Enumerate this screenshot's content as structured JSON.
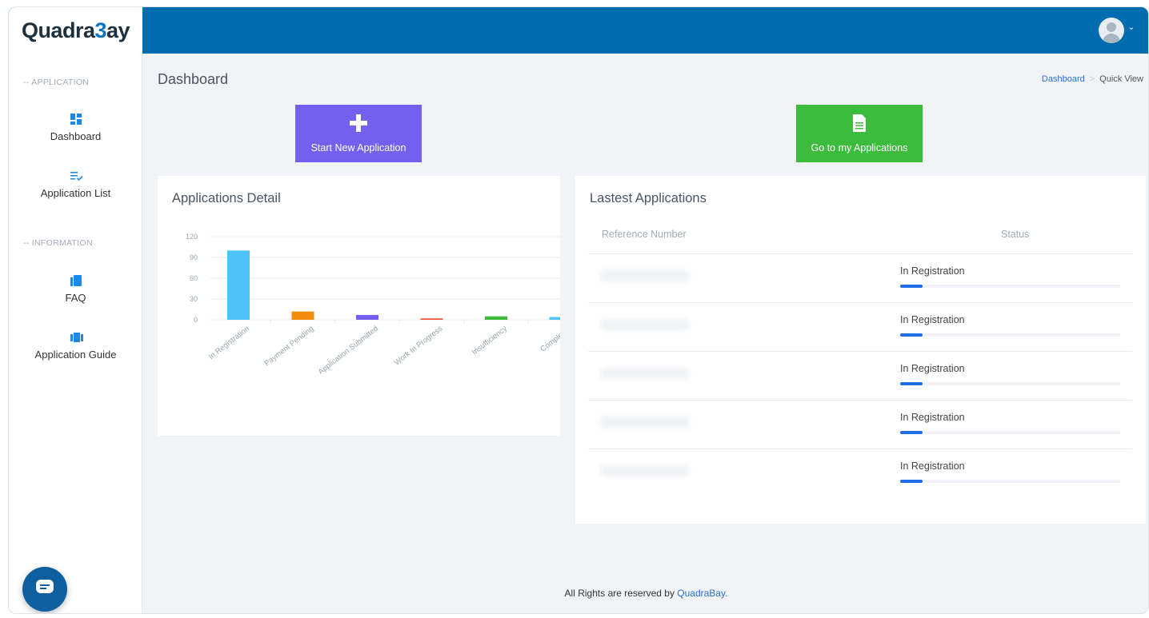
{
  "header": {
    "logo": {
      "prefix": "Quadra",
      "accent": "3",
      "suffix": "ay"
    },
    "brand_color": "#006cb0",
    "avatar_icon": "user-avatar-icon",
    "caret": "⌄"
  },
  "sidebar": {
    "sections": [
      {
        "label": "-- APPLICATION"
      },
      {
        "label": "-- INFORMATION"
      }
    ],
    "items": [
      {
        "label": "Dashboard",
        "icon": "dashboard-icon",
        "active": true
      },
      {
        "label": "Application List",
        "icon": "list-check-icon"
      },
      {
        "label": "FAQ",
        "icon": "book-icon"
      },
      {
        "label": "Application Guide",
        "icon": "guide-icon"
      }
    ]
  },
  "page": {
    "title": "Dashboard",
    "breadcrumb": {
      "link": "Dashboard",
      "separator": ">",
      "current": "Quick View"
    }
  },
  "actions": {
    "start": {
      "label": "Start New Application",
      "icon": "plus-icon",
      "color": "#7460ee"
    },
    "my_apps": {
      "label": "Go to my Applications",
      "icon": "document-icon",
      "color": "#3cbb3c"
    }
  },
  "chart_card": {
    "title": "Applications Detail"
  },
  "chart_data": {
    "type": "bar",
    "categories": [
      "In Registration",
      "Payment Pending",
      "Application Submitted",
      "Work In Progress",
      "Insufficiency",
      "Completed"
    ],
    "values": [
      100,
      12,
      7,
      2,
      5,
      4
    ],
    "colors": [
      "#4fc3f7",
      "#f28c0f",
      "#7460ee",
      "#f0513a",
      "#3cbb3c",
      "#4fc3f7"
    ],
    "yticks": [
      "120",
      "90",
      "60",
      "30",
      "0"
    ],
    "ylim": [
      0,
      120
    ],
    "grid": true
  },
  "latest": {
    "title": "Lastest Applications",
    "columns": [
      "Reference Number",
      "Status"
    ],
    "rows": [
      {
        "status": "In Registration",
        "progress": 0.1
      },
      {
        "status": "In Registration",
        "progress": 0.1
      },
      {
        "status": "In Registration",
        "progress": 0.1
      },
      {
        "status": "In Registration",
        "progress": 0.1
      },
      {
        "status": "In Registration",
        "progress": 0.1
      }
    ]
  },
  "footer": {
    "text": "All Rights are reserved by ",
    "brand": "QuadraBay."
  },
  "chat": {
    "icon": "chat-icon"
  }
}
